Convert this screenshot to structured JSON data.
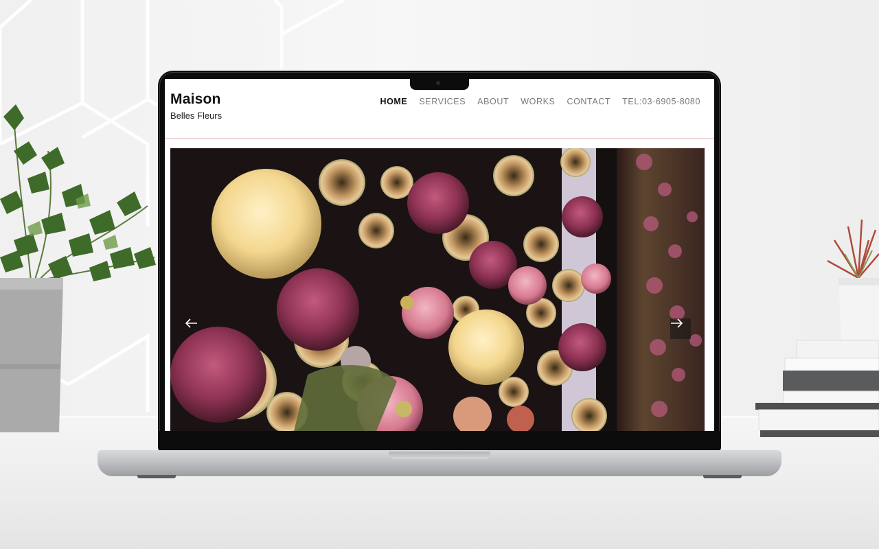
{
  "site": {
    "brand_title": "Maison",
    "brand_subtitle": "Belles Fleurs",
    "nav": [
      {
        "label": "HOME",
        "active": true
      },
      {
        "label": "SERVICES",
        "active": false
      },
      {
        "label": "ABOUT",
        "active": false
      },
      {
        "label": "WORKS",
        "active": false
      },
      {
        "label": "CONTACT",
        "active": false
      },
      {
        "label": "TEL:03-6905-8080",
        "active": false
      }
    ],
    "header_rule_color": "#f1d9d6"
  },
  "hero": {
    "prev_icon": "arrow-left-icon",
    "next_icon": "arrow-right-icon"
  },
  "colors": {
    "nav_active": "#111111",
    "nav_inactive": "#7a7a7a",
    "laptop_bezel": "#0c0c0c",
    "laptop_body": "#c3c4c7"
  }
}
